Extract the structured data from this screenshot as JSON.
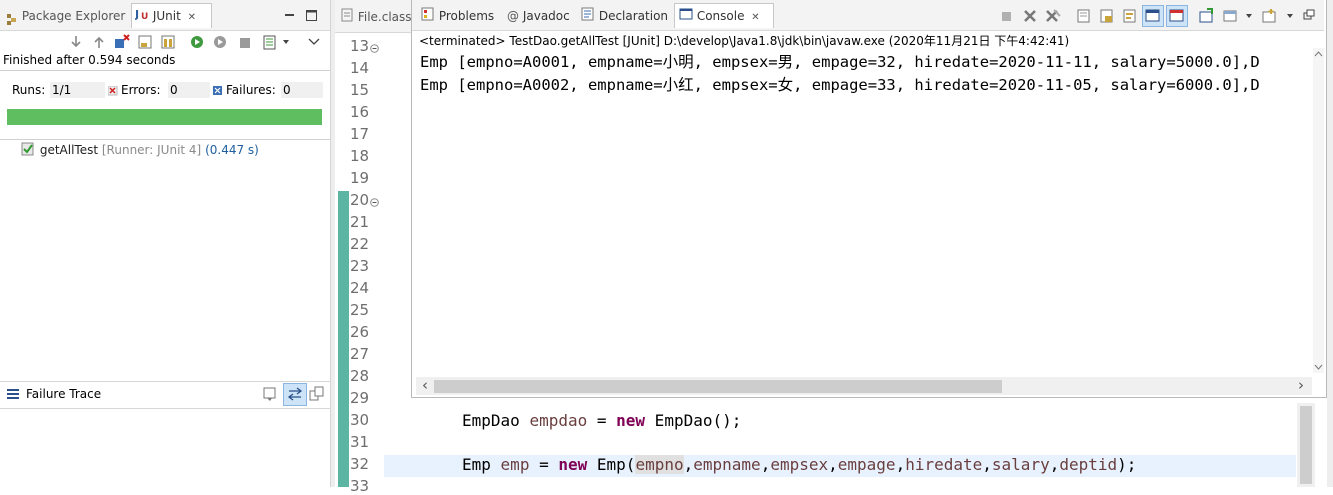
{
  "left_view": {
    "tabs": [
      {
        "label": "Package Explorer"
      },
      {
        "label": "JUnit",
        "close": "✕"
      }
    ],
    "status": "Finished after 0.594 seconds",
    "counters": {
      "runs_label": "Runs:",
      "runs_value": "1/1",
      "errors_label": "Errors:",
      "errors_value": "0",
      "failures_label": "Failures:",
      "failures_value": "0"
    },
    "progress_state": "success",
    "progress_fraction": 1.0,
    "progress_color": "#5fbe5f",
    "test": {
      "name": "getAllTest",
      "runner": "[Runner: JUnit 4]",
      "time": "(0.447 s)"
    },
    "failure_trace": {
      "label": "Failure Trace"
    }
  },
  "editor": {
    "tab_label": "File.class",
    "line_numbers": [
      "13",
      "14",
      "15",
      "16",
      "17",
      "18",
      "19",
      "20",
      "21",
      "22",
      "23",
      "24",
      "25",
      "26",
      "27",
      "28",
      "29",
      "30",
      "31",
      "32",
      "33"
    ],
    "fold_markers": [
      "13",
      "20"
    ],
    "code": {
      "line30": {
        "type": "EmpDao",
        "var": "empdao",
        "eq": " = ",
        "kw": "new",
        "ctor": " EmpDao();"
      },
      "line32": {
        "type": "Emp",
        "var": "emp",
        "eq": " = ",
        "kw": "new",
        "ctor": " Emp(",
        "args": [
          "empno",
          "empname",
          "empsex",
          "empage",
          "hiredate",
          "salary",
          "deptid"
        ],
        "comma": ",",
        "end": ");"
      }
    }
  },
  "console_view": {
    "tabs": [
      {
        "label": "Problems"
      },
      {
        "label": "Javadoc"
      },
      {
        "label": "Declaration"
      },
      {
        "label": "Console",
        "close": "✕"
      }
    ],
    "header": "<terminated> TestDao.getAllTest [JUnit] D:\\develop\\Java1.8\\jdk\\bin\\javaw.exe (2020年11月21日 下午4:42:41)",
    "output": [
      "Emp [empno=A0001, empname=小明, empsex=男, empage=32, hiredate=2020-11-11, salary=5000.0],D",
      "Emp [empno=A0002, empname=小红, empsex=女, empage=33, hiredate=2020-11-05, salary=6000.0],D"
    ],
    "scroll_left_arrow": "‹",
    "scroll_right_arrow": "›"
  },
  "colors": {
    "keyword": "#7f0055",
    "field": "#0000c0",
    "local_var": "#6a3e3e",
    "change_ruler": "#5bb5a2"
  }
}
